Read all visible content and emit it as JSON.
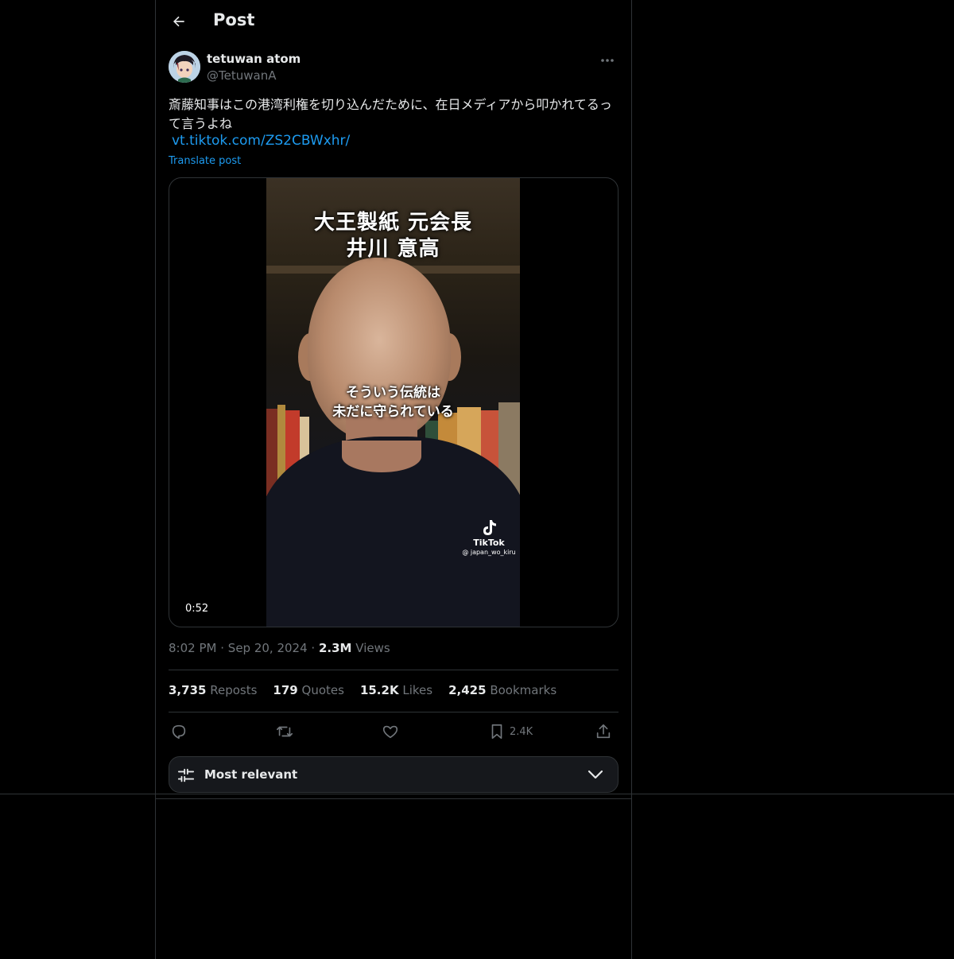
{
  "header": {
    "title": "Post"
  },
  "author": {
    "display_name": "tetuwan atom",
    "handle": "@TetuwanA"
  },
  "post": {
    "text": "斎藤知事はこの港湾利権を切り込んだために、在日メディアから叩かれてるって言うよね",
    "link": "vt.tiktok.com/ZS2CBWxhr/",
    "translate_label": "Translate post"
  },
  "media": {
    "overlay_title_line1": "大王製紙  元会長",
    "overlay_title_line2": "井川  意高",
    "overlay_caption_line1": "そういう伝統は",
    "overlay_caption_line2": "未だに守られている",
    "watermark_brand": "TikTok",
    "watermark_user": "@ japan_wo_kiru",
    "duration": "0:52"
  },
  "meta": {
    "time": "8:02 PM",
    "date": "Sep 20, 2024",
    "views_count": "2.3M",
    "views_label": "Views",
    "separator": "·"
  },
  "stats": {
    "reposts_count": "3,735",
    "reposts_label": "Reposts",
    "quotes_count": "179",
    "quotes_label": "Quotes",
    "likes_count": "15.2K",
    "likes_label": "Likes",
    "bookmarks_count": "2,425",
    "bookmarks_label": "Bookmarks"
  },
  "actions": {
    "bookmark_count": "2.4K"
  },
  "icons": {
    "back": "arrow-left-icon",
    "more": "more-horizontal-icon",
    "reply": "reply-icon",
    "repost": "repost-icon",
    "like": "heart-icon",
    "bookmark": "bookmark-icon",
    "share": "share-icon",
    "sort": "sliders-icon",
    "chevron": "chevron-down-icon"
  },
  "sort": {
    "label": "Most relevant"
  },
  "colors": {
    "background": "#000000",
    "text": "#e7e9ea",
    "muted": "#71767b",
    "link": "#1d9bf0",
    "border": "#2f3336"
  }
}
